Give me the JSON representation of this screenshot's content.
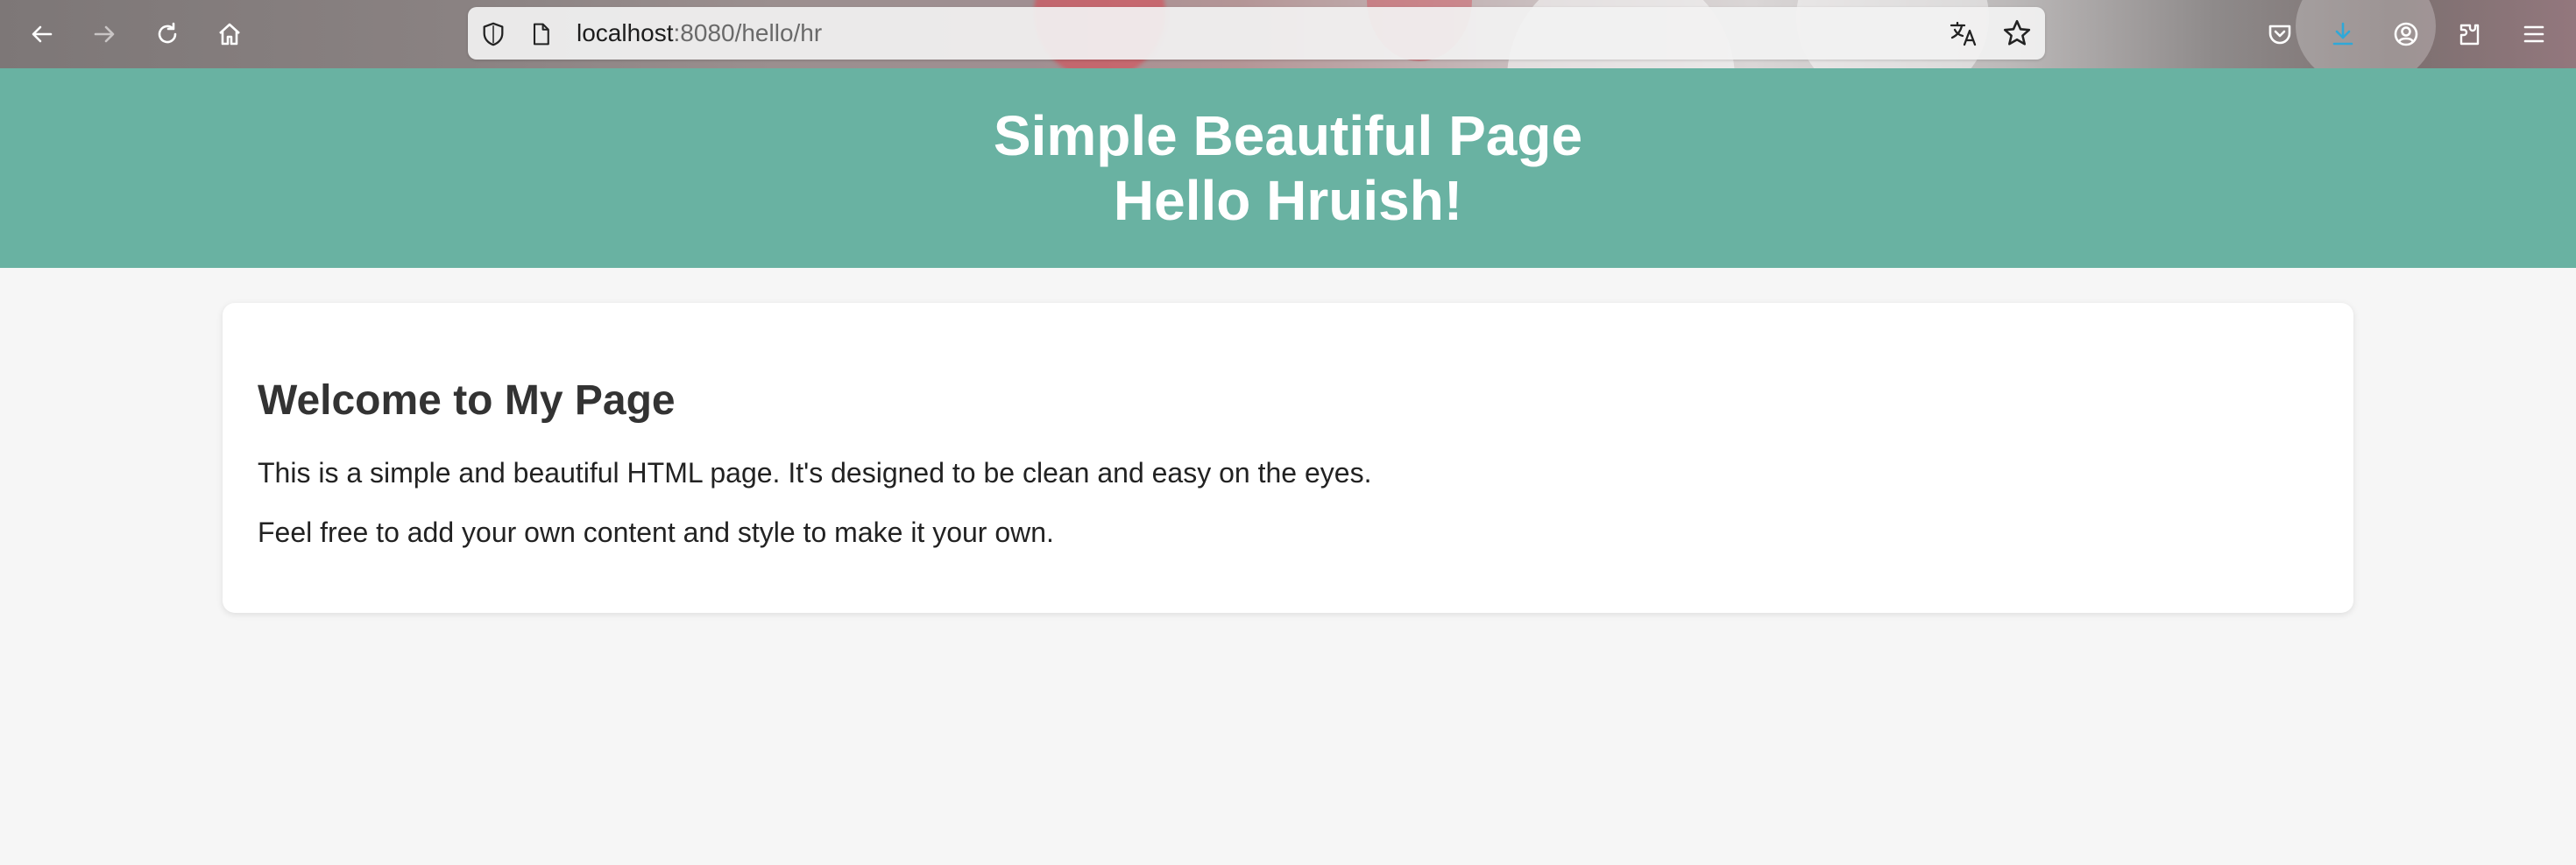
{
  "browser": {
    "url_host": "localhost",
    "url_rest": ":8080/hello/hr",
    "accent_color": "#2fa8d8"
  },
  "icons": {
    "back": "arrow-left-icon",
    "forward": "arrow-right-icon",
    "reload": "reload-icon",
    "home": "home-icon",
    "tracking_protection": "shield-icon",
    "page_info": "page-icon",
    "translate": "translate-icon",
    "bookmark": "star-icon",
    "pocket": "pocket-icon",
    "downloads": "download-icon",
    "account": "account-icon",
    "extensions": "puzzle-icon",
    "menu": "hamburger-menu-icon"
  },
  "header": {
    "title": "Simple Beautiful Page",
    "greeting": "Hello Hruish!",
    "background_color": "#69b2a2"
  },
  "content": {
    "heading": "Welcome to My Page",
    "paragraph_1": "This is a simple and beautiful HTML page. It's designed to be clean and easy on the eyes.",
    "paragraph_2": "Feel free to add your own content and style to make it your own."
  }
}
